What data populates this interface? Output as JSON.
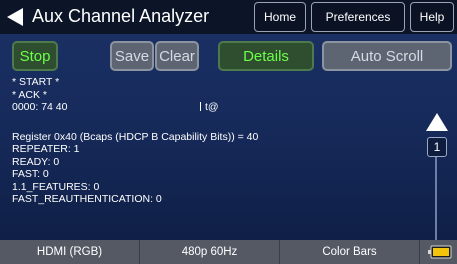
{
  "header": {
    "title": "Aux Channel Analyzer",
    "nav": {
      "home": "Home",
      "preferences": "Preferences",
      "help": "Help"
    }
  },
  "toolbar": {
    "stop": "Stop",
    "save": "Save",
    "clear": "Clear",
    "details": "Details",
    "auto_scroll": "Auto Scroll"
  },
  "log": {
    "start": "* START *",
    "ack": "* ACK  *",
    "data_addr": "0000: 74 40",
    "data_ascii": "t@",
    "register": "Register 0x40 (Bcaps (HDCP B Capability Bits)) = 40",
    "fields": [
      "REPEATER: 1",
      "READY: 0",
      "FAST: 0",
      "1.1_FEATURES: 0",
      "FAST_REAUTHENTICATION: 0"
    ]
  },
  "scroll": {
    "page": "1"
  },
  "status": {
    "video": "HDMI (RGB)",
    "format": "480p 60Hz",
    "pattern": "Color Bars"
  },
  "colors": {
    "panel": "#1a2f63",
    "active_text": "#6cff4a",
    "status_bar": "#545964"
  },
  "icons": {
    "back": "back-arrow-icon",
    "scroll_up": "scroll-up-icon",
    "scroll_down": "scroll-down-icon",
    "battery": "battery-icon"
  }
}
